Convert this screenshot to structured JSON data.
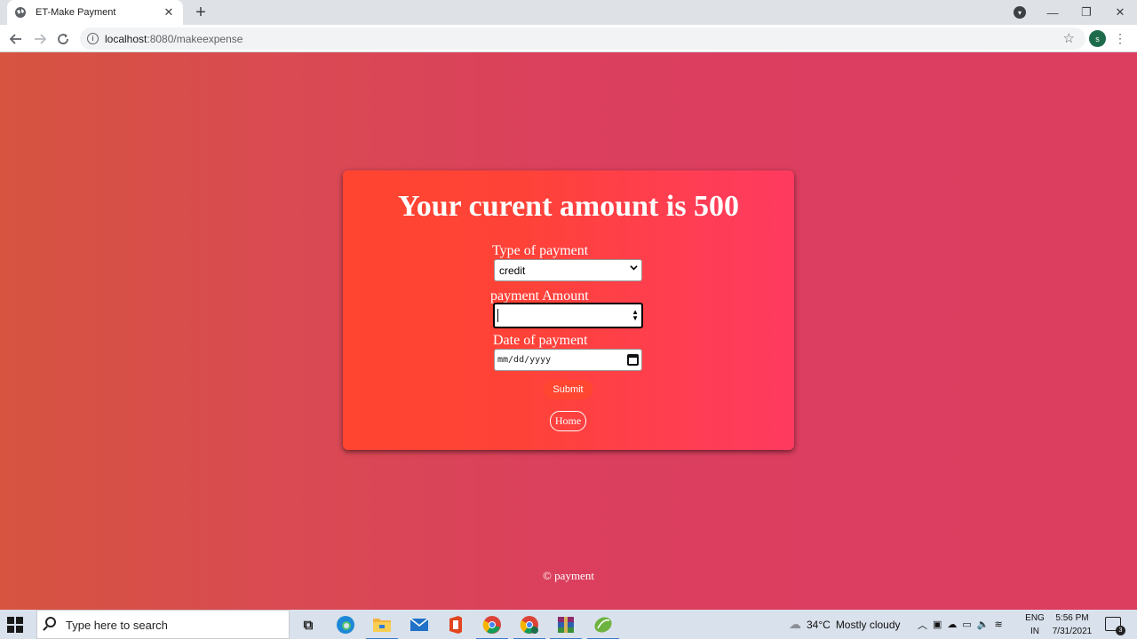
{
  "browser": {
    "tab_title": "ET-Make Payment",
    "tab_close": "✕",
    "new_tab": "+",
    "url_host": "localhost",
    "url_rest": ":8080/makeexpense",
    "avatar_letter": "s",
    "window_minimize": "—",
    "window_restore": "❐",
    "window_close": "✕"
  },
  "page": {
    "heading": "Your curent amount is 500",
    "fields": {
      "type_label": "Type of payment",
      "type_value": "credit",
      "amount_label": "payment Amount",
      "amount_value": "",
      "date_label": "Date of payment",
      "date_placeholder": "mm/dd/yyyy"
    },
    "submit_label": "Submit",
    "home_label": "Home",
    "footer": "© payment"
  },
  "taskbar": {
    "search_placeholder": "Type here to search",
    "weather_temp": "34°C",
    "weather_text": "Mostly cloudy",
    "lang_line1": "ENG",
    "lang_line2": "IN",
    "time": "5:56 PM",
    "date": "7/31/2021",
    "notification_count": "3",
    "pinned_apps": [
      "task-view",
      "edge",
      "file-explorer",
      "mail",
      "office",
      "chrome",
      "chrome-profile",
      "winrar",
      "spring-tool"
    ]
  },
  "colors": {
    "page_gradient_left": "#d65440",
    "page_gradient_right": "#dc3e60",
    "card_left": "#ff4530",
    "card_right": "#ff3a60",
    "submit_bg": "#ff4630"
  }
}
